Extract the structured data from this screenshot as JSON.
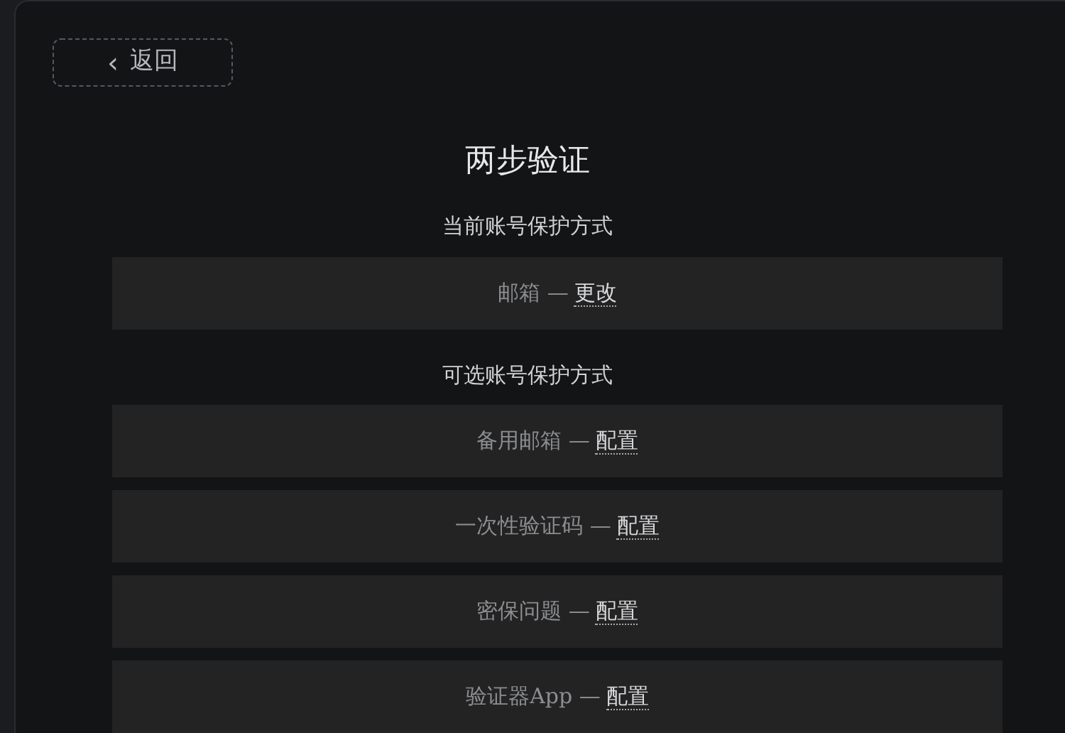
{
  "back_button": {
    "icon": "‹",
    "label": "返回"
  },
  "title": "两步验证",
  "sections": [
    {
      "heading": "当前账号保护方式",
      "items": [
        {
          "label": "邮箱 —",
          "action": "更改"
        }
      ]
    },
    {
      "heading": "可选账号保护方式",
      "items": [
        {
          "label": "备用邮箱 —",
          "action": "配置"
        },
        {
          "label": "一次性验证码 —",
          "action": "配置"
        },
        {
          "label": "密保问题 —",
          "action": "配置"
        },
        {
          "label": "验证器App —",
          "action": "配置"
        }
      ]
    }
  ]
}
